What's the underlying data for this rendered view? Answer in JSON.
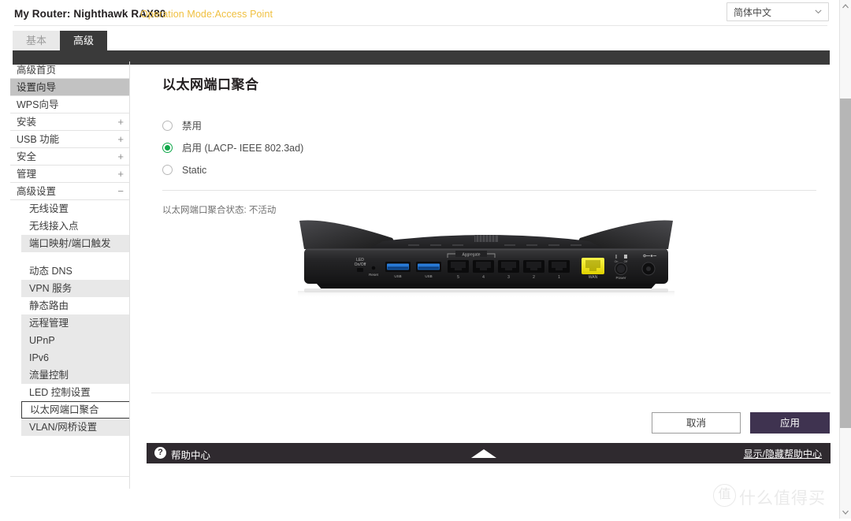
{
  "topbar": {
    "router_label": "My Router: Nighthawk RAX80",
    "operation_mode": "Operation Mode:Access Point",
    "operation_mode_color": "#f0c040",
    "language_selected": "简体中文",
    "language_chevron_icon": "chevron-down-icon"
  },
  "tabs": [
    {
      "label": "基本",
      "active": false
    },
    {
      "label": "高级",
      "active": true
    }
  ],
  "sidebar": {
    "items": [
      {
        "label": "高级首页",
        "expandable": false,
        "selected": false
      },
      {
        "label": "设置向导",
        "expandable": false,
        "selected": true
      },
      {
        "label": "WPS向导",
        "expandable": false,
        "selected": false
      },
      {
        "label": "安装",
        "expandable": true,
        "toggle": "+",
        "selected": false
      },
      {
        "label": "USB 功能",
        "expandable": true,
        "toggle": "+",
        "selected": false
      },
      {
        "label": "安全",
        "expandable": true,
        "toggle": "+",
        "selected": false
      },
      {
        "label": "管理",
        "expandable": true,
        "toggle": "+",
        "selected": false
      },
      {
        "label": "高级设置",
        "expandable": true,
        "toggle": "−",
        "selected": false
      }
    ],
    "subitems": [
      {
        "label": "无线设置",
        "shaded": false,
        "current": false
      },
      {
        "label": "无线接入点",
        "shaded": false,
        "current": false
      },
      {
        "label": "端口映射/端口触发",
        "shaded": true,
        "current": false
      },
      {
        "label": "",
        "spacer": true
      },
      {
        "label": "动态 DNS",
        "shaded": false,
        "current": false
      },
      {
        "label": "VPN 服务",
        "shaded": true,
        "current": false
      },
      {
        "label": "静态路由",
        "shaded": false,
        "current": false
      },
      {
        "label": "远程管理",
        "shaded": true,
        "current": false
      },
      {
        "label": "UPnP",
        "shaded": true,
        "current": false
      },
      {
        "label": "IPv6",
        "shaded": true,
        "current": false
      },
      {
        "label": "流量控制",
        "shaded": true,
        "current": false
      },
      {
        "label": "LED 控制设置",
        "shaded": false,
        "current": false
      },
      {
        "label": "以太网端口聚合",
        "shaded": false,
        "current": true
      },
      {
        "label": "VLAN/网桥设置",
        "shaded": true,
        "current": false
      }
    ]
  },
  "main": {
    "page_title": "以太网端口聚合",
    "radio_options": [
      {
        "label": "禁用",
        "selected": false
      },
      {
        "label": "启用 (LACP- IEEE 802.3ad)",
        "selected": true
      },
      {
        "label": "Static",
        "selected": false
      }
    ],
    "selected_color": "#10a84a",
    "status_text": "以太网端口聚合状态: 不活动",
    "router_image": {
      "name": "netgear-nighthawk-rax80-rear-panel",
      "labels": {
        "led": "LED",
        "led_sub": "On/Off",
        "reset": "Reset",
        "usb1": "USB",
        "usb2": "USB",
        "aggregate": "Aggregate",
        "lan_ports": [
          "5",
          "4",
          "3",
          "2",
          "1"
        ],
        "wan": "WAN",
        "power": "Power",
        "power_switch_on": "On",
        "power_switch_off": "Off"
      },
      "wan_port_color": "#f2e500",
      "usb_port_color": "#1f6fd0"
    },
    "buttons": {
      "cancel": "取消",
      "apply": "应用",
      "apply_color": "#3f3350"
    }
  },
  "footer": {
    "help_icon": "question-mark-icon",
    "help_center": "帮助中心",
    "collapse_icon": "triangle-up-icon",
    "toggle_link": "显示/隐藏帮助中心"
  },
  "watermark": {
    "mark": "值",
    "text": "什么值得买"
  },
  "scrollbar": {
    "up_icon": "chevron-up-icon",
    "down_icon": "chevron-down-icon"
  }
}
